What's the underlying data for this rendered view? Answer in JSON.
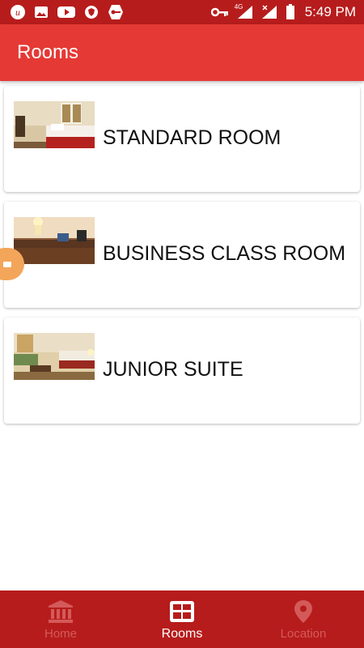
{
  "status_bar": {
    "time": "5:49 PM",
    "network_label": "4G",
    "left_icons": [
      "u-app-icon",
      "image-icon",
      "youtube-icon",
      "shield-icon",
      "key-badge-icon"
    ],
    "right_icons": [
      "vpn-key-icon",
      "signal-icon",
      "signal-off-icon",
      "battery-icon"
    ]
  },
  "app_bar": {
    "title": "Rooms"
  },
  "rooms": [
    {
      "name": "STANDARD ROOM",
      "thumbnail": "standard-room-photo"
    },
    {
      "name": "BUSINESS CLASS ROOM",
      "thumbnail": "business-room-photo"
    },
    {
      "name": "JUNIOR SUITE",
      "thumbnail": "junior-suite-photo"
    }
  ],
  "bottom_nav": {
    "items": [
      {
        "label": "Home",
        "icon": "bank-icon",
        "active": false
      },
      {
        "label": "Rooms",
        "icon": "grid-icon",
        "active": true
      },
      {
        "label": "Location",
        "icon": "location-pin-icon",
        "active": false
      }
    ]
  },
  "colors": {
    "status_bar": "#b71c1c",
    "app_bar": "#e53935",
    "bottom_nav": "#b71c1c",
    "nav_inactive": "#d45a5a",
    "handle": "#f3a55a"
  }
}
